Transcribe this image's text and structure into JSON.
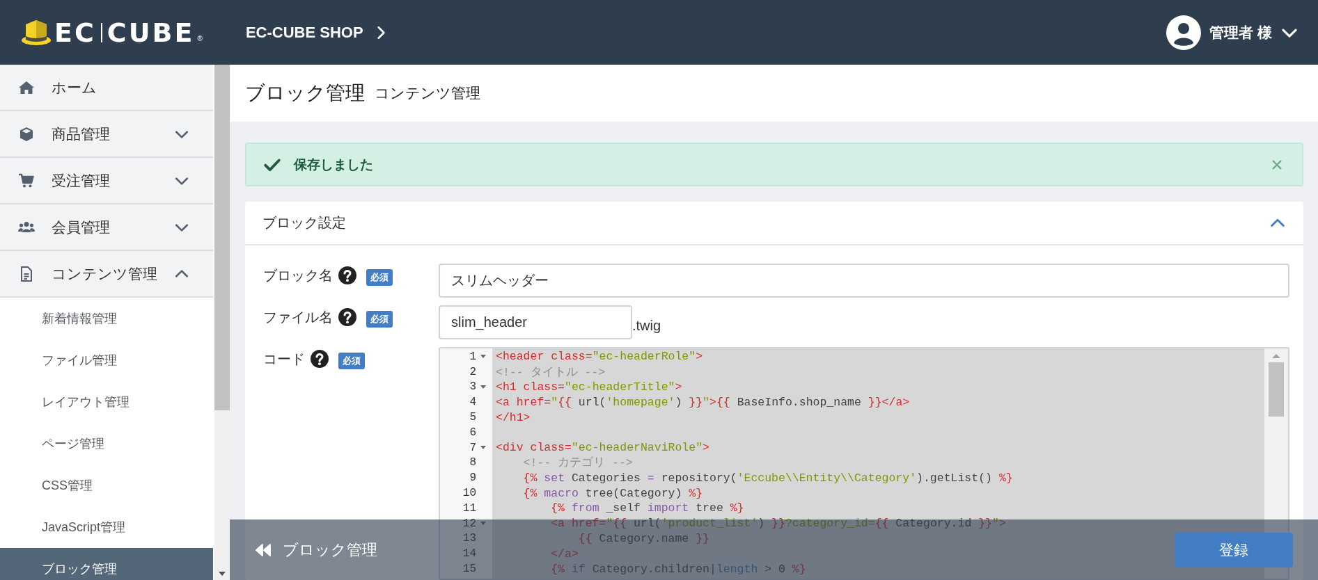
{
  "header": {
    "logo": {
      "left": "EC",
      "right": "CUBE",
      "mark": "®"
    },
    "shop_link": "EC-CUBE SHOP",
    "user": "管理者 様"
  },
  "sidebar": {
    "items": [
      {
        "label": "ホーム",
        "kind": "home"
      },
      {
        "label": "商品管理",
        "kind": "box",
        "expanded": false
      },
      {
        "label": "受注管理",
        "kind": "cart",
        "expanded": false
      },
      {
        "label": "会員管理",
        "kind": "users",
        "expanded": false
      },
      {
        "label": "コンテンツ管理",
        "kind": "file",
        "expanded": true,
        "children": [
          {
            "label": "新着情報管理",
            "selected": false
          },
          {
            "label": "ファイル管理",
            "selected": false
          },
          {
            "label": "レイアウト管理",
            "selected": false
          },
          {
            "label": "ページ管理",
            "selected": false
          },
          {
            "label": "CSS管理",
            "selected": false
          },
          {
            "label": "JavaScript管理",
            "selected": false
          },
          {
            "label": "ブロック管理",
            "selected": true
          }
        ]
      }
    ]
  },
  "page": {
    "title": "ブロック管理",
    "subtitle": "コンテンツ管理"
  },
  "alert": {
    "kind": "success",
    "message": "保存しました"
  },
  "card": {
    "title": "ブロック設定",
    "expanded": true,
    "fields": [
      {
        "kind": "text",
        "label": "ブロック名",
        "required": "必須",
        "value": "スリムヘッダー"
      },
      {
        "kind": "file",
        "label": "ファイル名",
        "required": "必須",
        "value": "slim_header",
        "suffix": ".twig"
      },
      {
        "kind": "code",
        "label": "コード",
        "required": "必須",
        "lines": [
          {
            "number": "1",
            "fold": true,
            "segments": [
              {
                "text": "<header class=",
                "kind": "markup"
              },
              {
                "text": "\"ec-headerRole\"",
                "kind": "string"
              },
              {
                "text": ">",
                "kind": "markup"
              }
            ]
          },
          {
            "number": "2",
            "fold": false,
            "segments": [
              {
                "text": "<!-- タイトル -->",
                "kind": "comment"
              }
            ]
          },
          {
            "number": "3",
            "fold": true,
            "segments": [
              {
                "text": "<h1 class=",
                "kind": "markup"
              },
              {
                "text": "\"ec-headerTitle\"",
                "kind": "string"
              },
              {
                "text": ">",
                "kind": "markup"
              }
            ]
          },
          {
            "number": "4",
            "fold": false,
            "segments": [
              {
                "text": "<a href=",
                "kind": "markup"
              },
              {
                "text": "\"",
                "kind": "string"
              },
              {
                "text": "{{",
                "kind": "markup"
              },
              {
                "text": " url(",
                "kind": "plain"
              },
              {
                "text": "'homepage'",
                "kind": "string"
              },
              {
                "text": ") ",
                "kind": "plain"
              },
              {
                "text": "}}",
                "kind": "markup"
              },
              {
                "text": "\"",
                "kind": "string"
              },
              {
                "text": ">{{",
                "kind": "markup"
              },
              {
                "text": " BaseInfo.shop_name ",
                "kind": "plain"
              },
              {
                "text": "}}</a>",
                "kind": "markup"
              }
            ]
          },
          {
            "number": "5",
            "fold": false,
            "segments": [
              {
                "text": "</h1>",
                "kind": "markup"
              }
            ]
          },
          {
            "number": "6",
            "fold": false
          },
          {
            "number": "7",
            "fold": true,
            "segments": [
              {
                "text": "<div class=",
                "kind": "markup"
              },
              {
                "text": "\"ec-headerNaviRole\"",
                "kind": "string"
              },
              {
                "text": ">",
                "kind": "markup"
              }
            ]
          },
          {
            "number": "8",
            "fold": false,
            "segments": [
              {
                "text": "    <!-- カテゴリ -->",
                "kind": "comment"
              }
            ]
          },
          {
            "number": "9",
            "fold": false,
            "segments": [
              {
                "text": "    {%",
                "kind": "markup"
              },
              {
                "text": " set",
                "kind": "keyword"
              },
              {
                "text": " Categories ",
                "kind": "plain"
              },
              {
                "text": "=",
                "kind": "keyword"
              },
              {
                "text": " repository(",
                "kind": "plain"
              },
              {
                "text": "'Eccube\\\\Entity\\\\Category'",
                "kind": "string"
              },
              {
                "text": ").getList() ",
                "kind": "plain"
              },
              {
                "text": "%}",
                "kind": "markup"
              }
            ]
          },
          {
            "number": "10",
            "fold": false,
            "segments": [
              {
                "text": "    {%",
                "kind": "markup"
              },
              {
                "text": " macro",
                "kind": "keyword"
              },
              {
                "text": " tree(Category) ",
                "kind": "plain"
              },
              {
                "text": "%}",
                "kind": "markup"
              }
            ]
          },
          {
            "number": "11",
            "fold": false,
            "segments": [
              {
                "text": "        {%",
                "kind": "markup"
              },
              {
                "text": " from",
                "kind": "keyword"
              },
              {
                "text": " _self ",
                "kind": "plain"
              },
              {
                "text": "import",
                "kind": "keyword"
              },
              {
                "text": " tree ",
                "kind": "plain"
              },
              {
                "text": "%}",
                "kind": "markup"
              }
            ]
          },
          {
            "number": "12",
            "fold": true,
            "segments": [
              {
                "text": "        <a href=",
                "kind": "markup"
              },
              {
                "text": "\"",
                "kind": "string"
              },
              {
                "text": "{{",
                "kind": "markup"
              },
              {
                "text": " url(",
                "kind": "plain"
              },
              {
                "text": "'product_list'",
                "kind": "string"
              },
              {
                "text": ") ",
                "kind": "plain"
              },
              {
                "text": "}}",
                "kind": "markup"
              },
              {
                "text": "?category_id=",
                "kind": "string"
              },
              {
                "text": "{{",
                "kind": "markup"
              },
              {
                "text": " Category.id ",
                "kind": "plain"
              },
              {
                "text": "}}",
                "kind": "markup"
              },
              {
                "text": "\"",
                "kind": "string"
              },
              {
                "text": ">",
                "kind": "markup"
              }
            ]
          },
          {
            "number": "13",
            "fold": false,
            "segments": [
              {
                "text": "            {{",
                "kind": "markup"
              },
              {
                "text": " Category.name ",
                "kind": "plain"
              },
              {
                "text": "}}",
                "kind": "markup"
              }
            ]
          },
          {
            "number": "14",
            "fold": false,
            "segments": [
              {
                "text": "        </a>",
                "kind": "markup"
              }
            ]
          },
          {
            "number": "15",
            "fold": false,
            "segments": [
              {
                "text": "        {%",
                "kind": "markup"
              },
              {
                "text": " if",
                "kind": "keyword"
              },
              {
                "text": " Category.children|",
                "kind": "plain"
              },
              {
                "text": "length",
                "kind": "filter"
              },
              {
                "text": " > ",
                "kind": "plain"
              },
              {
                "text": "0",
                "kind": "number"
              },
              {
                "text": " %}",
                "kind": "markup"
              }
            ]
          }
        ]
      }
    ]
  },
  "footer": {
    "back": "ブロック管理",
    "submit": "登録"
  }
}
